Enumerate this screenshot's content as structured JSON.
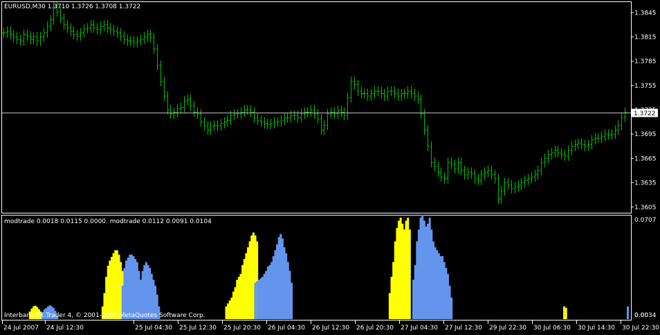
{
  "main_header": "EURUSD,M30  1.3710 1.3726 1.3708 1.3722",
  "indicator_header": "modtrade 0.0018 0.0115 0.0000. modtrade 0.0112 0.0091 0.0104",
  "copyright": "Interbank FX Trader 4, © 2001-2007 MetaQuotes Software Corp.",
  "current_price_label": "1.3722",
  "colors": {
    "candles": "#00c000",
    "grid_line": "#c0c0c0",
    "series_yellow": "#ffff00",
    "series_blue": "#6495ed",
    "axis": "#ffffff"
  },
  "chart_data": [
    {
      "type": "line",
      "title": "EURUSD,M30",
      "price_axis_ticks": [
        "1.3845",
        "1.3815",
        "1.3785",
        "1.3755",
        "1.3725",
        "1.3695",
        "1.3665",
        "1.3635",
        "1.3605"
      ],
      "current_price": 1.3722,
      "ylim": [
        1.3598,
        1.3858
      ],
      "time_axis_ticks": [
        "24 Jul 2007",
        "24 Jul 12:30",
        "25 Jul 04:30",
        "25 Jul 12:30",
        "25 Jul 20:30",
        "26 Jul 04:30",
        "26 Jul 12:30",
        "26 Jul 20:30",
        "27 Jul 04:30",
        "27 Jul 12:30",
        "29 Jul 22:30",
        "30 Jul 06:30",
        "30 Jul 14:30",
        "30 Jul 22:30"
      ],
      "series": [
        {
          "values": [
            1.382,
            1.3822,
            1.3818,
            1.3815,
            1.3812,
            1.381,
            1.3818,
            1.3816,
            1.3812,
            1.3815,
            1.381,
            1.3815,
            1.382,
            1.3828,
            1.3836,
            1.3852,
            1.3846,
            1.3838,
            1.383,
            1.3826,
            1.3822,
            1.3818,
            1.3816,
            1.382,
            1.3825,
            1.3826,
            1.383,
            1.3826,
            1.3824,
            1.3828,
            1.383,
            1.3826,
            1.3824,
            1.3822,
            1.382,
            1.3816,
            1.3812,
            1.381,
            1.381,
            1.3808,
            1.381,
            1.3812,
            1.3815,
            1.3818,
            1.3814,
            1.38,
            1.378,
            1.376,
            1.3742,
            1.3725,
            1.372,
            1.3722,
            1.3726,
            1.3728,
            1.3736,
            1.3738,
            1.373,
            1.3722,
            1.372,
            1.371,
            1.3705,
            1.37,
            1.3705,
            1.3706,
            1.3705,
            1.3708,
            1.371,
            1.3712,
            1.3718,
            1.372,
            1.372,
            1.3722,
            1.3725,
            1.3725,
            1.3722,
            1.3715,
            1.3712,
            1.371,
            1.3708,
            1.3707,
            1.3708,
            1.371,
            1.371,
            1.3712,
            1.3715,
            1.3715,
            1.3718,
            1.3718,
            1.3715,
            1.372,
            1.3722,
            1.3722,
            1.3725,
            1.372,
            1.3714,
            1.37,
            1.3706,
            1.372,
            1.3722,
            1.372,
            1.3724,
            1.3722,
            1.3718,
            1.374,
            1.376,
            1.3756,
            1.3748,
            1.3745,
            1.3745,
            1.3742,
            1.3745,
            1.3748,
            1.3748,
            1.3745,
            1.3742,
            1.3748,
            1.3748,
            1.3745,
            1.3742,
            1.3745,
            1.3745,
            1.3748,
            1.3745,
            1.3742,
            1.3738,
            1.372,
            1.37,
            1.368,
            1.366,
            1.3655,
            1.3648,
            1.3642,
            1.364,
            1.366,
            1.3658,
            1.3652,
            1.366,
            1.365,
            1.3645,
            1.3648,
            1.3646,
            1.364,
            1.3638,
            1.3645,
            1.3648,
            1.365,
            1.3645,
            1.364,
            1.3615,
            1.3625,
            1.3635,
            1.3632,
            1.3628,
            1.363,
            1.3632,
            1.3635,
            1.3638,
            1.364,
            1.3642,
            1.3645,
            1.365,
            1.366,
            1.3665,
            1.367,
            1.3672,
            1.3675,
            1.3672,
            1.367,
            1.3668,
            1.3675,
            1.368,
            1.3682,
            1.3684,
            1.3682,
            1.368,
            1.3682,
            1.3688,
            1.369,
            1.369,
            1.3692,
            1.3695,
            1.3694,
            1.3695,
            1.37,
            1.3706,
            1.3716,
            1.3722
          ]
        }
      ]
    },
    {
      "type": "area",
      "title": "modtrade",
      "ylim": [
        0.0034,
        0.0707
      ],
      "value_axis_ticks": [
        "0.0707",
        "0.0034"
      ],
      "value_axis_overlay": "0.00",
      "series": [
        {
          "color": "yellow",
          "values": [
            0,
            0,
            0,
            0,
            0,
            0,
            0,
            0,
            0,
            0,
            0,
            0,
            0,
            0,
            0.0085,
            0.0105,
            0.012,
            0.0125,
            0.0115,
            0.01,
            0.0085,
            0,
            0,
            0,
            0,
            0,
            0,
            0,
            0,
            0,
            0,
            0,
            0,
            0,
            0,
            0,
            0,
            0,
            0,
            0,
            0,
            0,
            0,
            0,
            0,
            0,
            0,
            0,
            0,
            0,
            0,
            0,
            0,
            0,
            0.012,
            0.021,
            0.032,
            0.0395,
            0.043,
            0.0455,
            0.048,
            0.05,
            0.05,
            0.047,
            0.042,
            0.036,
            0,
            0,
            0,
            0,
            0,
            0,
            0,
            0,
            0,
            0,
            0,
            0,
            0,
            0,
            0,
            0,
            0,
            0,
            0,
            0,
            0,
            0,
            0,
            0,
            0,
            0,
            0,
            0,
            0,
            0,
            0,
            0,
            0,
            0,
            0,
            0,
            0,
            0,
            0,
            0,
            0,
            0,
            0,
            0,
            0,
            0,
            0,
            0,
            0,
            0,
            0,
            0,
            0,
            0,
            0,
            0,
            0.012,
            0.014,
            0.016,
            0.018,
            0.022,
            0.025,
            0.03,
            0.032,
            0.034,
            0.04,
            0.044,
            0.048,
            0.052,
            0.056,
            0.06,
            0.062,
            0.06,
            0.056,
            0,
            0,
            0,
            0,
            0,
            0,
            0,
            0,
            0,
            0,
            0,
            0,
            0,
            0,
            0,
            0,
            0,
            0,
            0,
            0,
            0,
            0,
            0,
            0,
            0,
            0,
            0,
            0,
            0,
            0,
            0,
            0,
            0,
            0,
            0,
            0,
            0,
            0,
            0,
            0,
            0,
            0,
            0,
            0,
            0,
            0,
            0,
            0,
            0,
            0,
            0,
            0,
            0,
            0,
            0,
            0,
            0,
            0,
            0,
            0,
            0,
            0,
            0,
            0,
            0,
            0,
            0,
            0,
            0,
            0,
            0,
            0,
            0.021,
            0.032,
            0.042,
            0.056,
            0.065,
            0.07,
            0.072,
            0.068,
            0.064,
            0.07,
            0.072,
            0.064,
            0,
            0,
            0,
            0,
            0,
            0,
            0,
            0,
            0,
            0,
            0,
            0,
            0,
            0,
            0,
            0,
            0,
            0,
            0,
            0,
            0,
            0,
            0,
            0,
            0,
            0,
            0,
            0,
            0,
            0,
            0,
            0,
            0,
            0,
            0,
            0,
            0,
            0,
            0,
            0,
            0,
            0,
            0,
            0,
            0,
            0,
            0,
            0,
            0,
            0,
            0,
            0,
            0,
            0,
            0,
            0,
            0,
            0,
            0,
            0,
            0,
            0,
            0,
            0,
            0,
            0,
            0,
            0,
            0,
            0,
            0,
            0,
            0,
            0,
            0,
            0,
            0,
            0,
            0,
            0,
            0,
            0,
            0,
            0,
            0.012,
            0.011,
            0,
            0,
            0,
            0,
            0,
            0,
            0,
            0,
            0,
            0,
            0,
            0,
            0,
            0
          ]
        },
        {
          "color": "blue",
          "values": [
            0,
            0,
            0,
            0,
            0,
            0,
            0,
            0,
            0,
            0,
            0,
            0,
            0,
            0,
            0,
            0,
            0,
            0,
            0,
            0,
            0,
            0.008,
            0.01,
            0.011,
            0.012,
            0.0128,
            0.012,
            0.011,
            0.009,
            0.006,
            0,
            0,
            0,
            0,
            0,
            0,
            0,
            0,
            0,
            0,
            0,
            0,
            0,
            0,
            0,
            0,
            0,
            0,
            0,
            0,
            0,
            0,
            0,
            0,
            0,
            0,
            0,
            0,
            0,
            0,
            0,
            0,
            0,
            0,
            0,
            0.026,
            0.038,
            0.043,
            0.045,
            0.047,
            0.047,
            0.046,
            0.044,
            0.042,
            0.036,
            0.03,
            0.036,
            0.04,
            0.042,
            0.04,
            0.038,
            0.034,
            0.03,
            0.026,
            0.02,
            0.012,
            0,
            0,
            0,
            0,
            0,
            0,
            0,
            0,
            0,
            0,
            0,
            0,
            0,
            0,
            0,
            0,
            0,
            0,
            0,
            0,
            0,
            0,
            0,
            0,
            0,
            0,
            0,
            0,
            0,
            0,
            0,
            0,
            0,
            0,
            0,
            0,
            0,
            0,
            0,
            0,
            0,
            0,
            0,
            0,
            0,
            0,
            0,
            0,
            0,
            0,
            0,
            0,
            0.028,
            0.029,
            0.03,
            0.031,
            0.032,
            0.034,
            0.036,
            0.039,
            0.04,
            0.042,
            0.046,
            0.05,
            0.054,
            0.059,
            0.061,
            0.058,
            0.052,
            0.048,
            0.042,
            0.036,
            0.028,
            0,
            0,
            0,
            0,
            0,
            0,
            0,
            0,
            0,
            0,
            0,
            0,
            0,
            0,
            0,
            0,
            0,
            0,
            0,
            0,
            0,
            0,
            0,
            0,
            0,
            0,
            0,
            0,
            0,
            0,
            0,
            0,
            0,
            0,
            0,
            0,
            0,
            0,
            0,
            0,
            0,
            0,
            0,
            0,
            0,
            0,
            0,
            0,
            0,
            0,
            0,
            0,
            0,
            0,
            0,
            0,
            0,
            0,
            0,
            0,
            0,
            0,
            0,
            0,
            0,
            0,
            0.03,
            0.04,
            0.056,
            0.064,
            0.072,
            0.074,
            0.07,
            0.066,
            0.068,
            0.072,
            0.064,
            0.056,
            0.052,
            0.05,
            0.048,
            0.046,
            0.046,
            0.042,
            0.038,
            0.034,
            0.026,
            0.018,
            0,
            0,
            0,
            0,
            0,
            0,
            0,
            0,
            0,
            0,
            0,
            0,
            0,
            0,
            0,
            0,
            0,
            0,
            0,
            0,
            0,
            0,
            0,
            0,
            0,
            0,
            0,
            0,
            0,
            0,
            0,
            0,
            0,
            0,
            0,
            0,
            0,
            0,
            0,
            0,
            0,
            0,
            0,
            0,
            0,
            0,
            0,
            0,
            0,
            0,
            0,
            0,
            0,
            0,
            0,
            0,
            0,
            0,
            0,
            0,
            0,
            0,
            0,
            0,
            0,
            0,
            0,
            0,
            0,
            0,
            0,
            0,
            0,
            0,
            0,
            0,
            0,
            0,
            0,
            0,
            0,
            0,
            0,
            0,
            0,
            0,
            0,
            0,
            0,
            0,
            0,
            0,
            0,
            0,
            0,
            0,
            0.012
          ]
        }
      ]
    }
  ]
}
